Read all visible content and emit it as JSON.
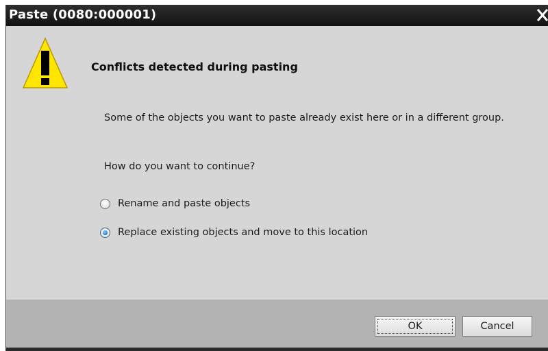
{
  "window": {
    "title": "Paste (0080:000001)",
    "close_icon": "close-icon"
  },
  "dialog": {
    "icon": "warning-icon",
    "heading": "Conflicts detected during pasting",
    "message": "Some of the objects you want to paste already exist here or in a different group.",
    "question": "How do you want to continue?",
    "options": [
      {
        "label": "Rename and paste objects",
        "selected": false
      },
      {
        "label": "Replace existing objects and move to this location",
        "selected": true
      }
    ]
  },
  "buttons": {
    "ok_label": "OK",
    "cancel_label": "Cancel"
  },
  "colors": {
    "titlebar": "#1e1e1e",
    "body": "#d6d6d6",
    "footer": "#b3b3b3",
    "warning": "#ffe600"
  }
}
